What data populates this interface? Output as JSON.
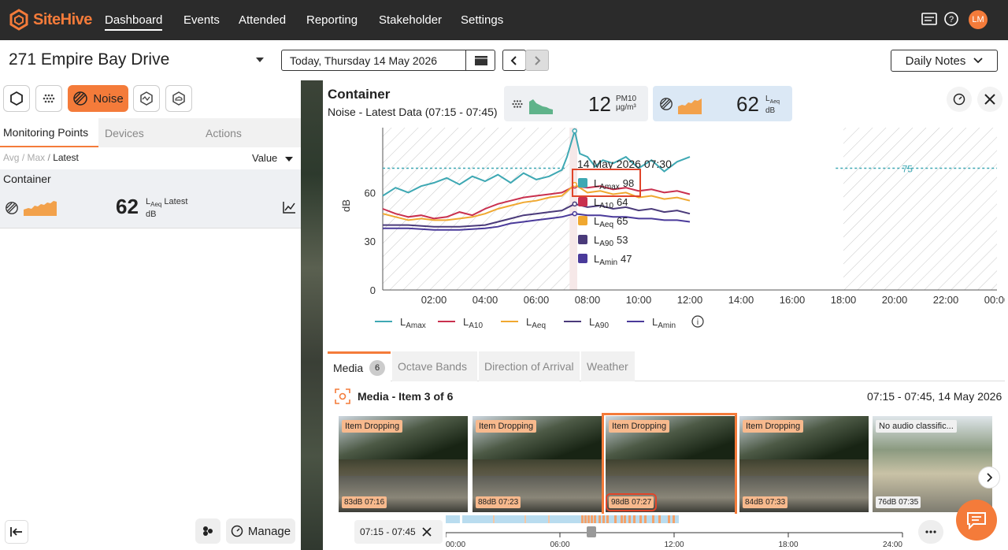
{
  "nav": {
    "brand": "SiteHive",
    "items": [
      {
        "label": "Dashboard",
        "active": true
      },
      {
        "label": "Events"
      },
      {
        "label": "Attended"
      },
      {
        "label": "Reporting"
      },
      {
        "label": "Stakeholder"
      },
      {
        "label": "Settings"
      }
    ],
    "icons": [
      "notes-icon",
      "help-icon"
    ],
    "avatar": "LM"
  },
  "header": {
    "site": "271 Empire Bay Drive",
    "date": "Today, Thursday 14 May 2026",
    "daily_notes": "Daily Notes"
  },
  "filters": {
    "noise_label": "Noise"
  },
  "left": {
    "tabs": [
      "Monitoring Points",
      "Devices",
      "Actions"
    ],
    "crumb_avg": "Avg",
    "crumb_sep": "/",
    "crumb_max": "Max",
    "crumb_latest": "Latest",
    "value_label": "Value",
    "point": {
      "name": "Container",
      "value": "62",
      "metric_main": "L",
      "metric_sub": "Aeq",
      "metric_suffix": "Latest",
      "unit": "dB"
    },
    "manage": "Manage"
  },
  "panel": {
    "title": "Container",
    "subtitle": "Noise - Latest Data (07:15 - 07:45)",
    "pm": {
      "value": "12",
      "label": "PM10",
      "unit": "µg/m³"
    },
    "noise": {
      "value": "62",
      "label_main": "L",
      "label_sub": "Aeq",
      "unit": "dB"
    }
  },
  "chart_data": {
    "type": "line",
    "ylabel": "dB",
    "yticks": [
      "0",
      "30",
      "60"
    ],
    "ylim": [
      0,
      100
    ],
    "xticks": [
      "02:00",
      "04:00",
      "06:00",
      "08:00",
      "10:00",
      "12:00",
      "14:00",
      "16:00",
      "18:00",
      "20:00",
      "22:00",
      "00:00"
    ],
    "xlim": [
      0,
      24
    ],
    "threshold_label": "75",
    "threshold": 75,
    "tooltip": {
      "time": "14 May 2026 07:30",
      "rows": [
        {
          "main": "L",
          "sub": "Amax",
          "value": "98",
          "color": "#3ea8b3"
        },
        {
          "main": "L",
          "sub": "A10",
          "value": "64",
          "color": "#c9304e"
        },
        {
          "main": "L",
          "sub": "Aeq",
          "value": "65",
          "color": "#f0a830"
        },
        {
          "main": "L",
          "sub": "A90",
          "value": "53",
          "color": "#4a3a7a"
        },
        {
          "main": "L",
          "sub": "Amin",
          "value": "47",
          "color": "#4a3a9a"
        }
      ]
    },
    "series": [
      {
        "name": "LAmax",
        "color": "#3ea8b3",
        "points": [
          [
            0,
            58
          ],
          [
            0.5,
            63
          ],
          [
            1,
            60
          ],
          [
            1.5,
            64
          ],
          [
            2,
            66
          ],
          [
            2.5,
            69
          ],
          [
            3,
            65
          ],
          [
            3.5,
            70
          ],
          [
            4,
            67
          ],
          [
            4.5,
            71
          ],
          [
            5,
            66
          ],
          [
            5.5,
            72
          ],
          [
            6,
            68
          ],
          [
            6.5,
            70
          ],
          [
            7,
            74
          ],
          [
            7.2,
            82
          ],
          [
            7.5,
            98
          ],
          [
            7.7,
            84
          ],
          [
            8,
            82
          ],
          [
            8.3,
            76
          ],
          [
            8.6,
            80
          ],
          [
            9,
            78
          ],
          [
            9.5,
            82
          ],
          [
            10,
            75
          ],
          [
            10.5,
            80
          ],
          [
            11,
            73
          ],
          [
            11.5,
            79
          ],
          [
            12,
            82
          ]
        ]
      },
      {
        "name": "LA10",
        "color": "#c9304e",
        "points": [
          [
            0,
            50
          ],
          [
            0.5,
            47
          ],
          [
            1,
            45
          ],
          [
            1.5,
            46
          ],
          [
            2,
            44
          ],
          [
            2.5,
            45
          ],
          [
            3,
            48
          ],
          [
            3.5,
            46
          ],
          [
            4,
            50
          ],
          [
            4.5,
            53
          ],
          [
            5,
            55
          ],
          [
            5.5,
            57
          ],
          [
            6,
            58
          ],
          [
            6.5,
            59
          ],
          [
            7,
            60
          ],
          [
            7.5,
            64
          ],
          [
            8,
            63
          ],
          [
            8.5,
            64
          ],
          [
            9,
            62
          ],
          [
            9.5,
            63
          ],
          [
            10,
            61
          ],
          [
            10.5,
            62
          ],
          [
            11,
            60
          ],
          [
            11.5,
            61
          ],
          [
            12,
            59
          ]
        ]
      },
      {
        "name": "LAeq",
        "color": "#f0a830",
        "points": [
          [
            0,
            47
          ],
          [
            0.5,
            45
          ],
          [
            1,
            43
          ],
          [
            1.5,
            44
          ],
          [
            2,
            43
          ],
          [
            2.5,
            43
          ],
          [
            3,
            44
          ],
          [
            3.5,
            45
          ],
          [
            4,
            47
          ],
          [
            4.5,
            50
          ],
          [
            5,
            52
          ],
          [
            5.5,
            54
          ],
          [
            6,
            55
          ],
          [
            6.5,
            57
          ],
          [
            7,
            58
          ],
          [
            7.5,
            65
          ],
          [
            8,
            60
          ],
          [
            8.5,
            61
          ],
          [
            9,
            59
          ],
          [
            9.5,
            60
          ],
          [
            10,
            57
          ],
          [
            10.5,
            58
          ],
          [
            11,
            56
          ],
          [
            11.5,
            57
          ],
          [
            12,
            55
          ]
        ]
      },
      {
        "name": "LA90",
        "color": "#4a3a7a",
        "points": [
          [
            0,
            40
          ],
          [
            1,
            40
          ],
          [
            2,
            39
          ],
          [
            3,
            39
          ],
          [
            4,
            40
          ],
          [
            4.5,
            42
          ],
          [
            5,
            44
          ],
          [
            5.5,
            46
          ],
          [
            6,
            47
          ],
          [
            6.5,
            48
          ],
          [
            7,
            49
          ],
          [
            7.5,
            53
          ],
          [
            8,
            51
          ],
          [
            8.5,
            52
          ],
          [
            9,
            50
          ],
          [
            9.5,
            51
          ],
          [
            10,
            49
          ],
          [
            10.5,
            50
          ],
          [
            11,
            48
          ],
          [
            11.5,
            49
          ],
          [
            12,
            47
          ]
        ]
      },
      {
        "name": "LAmin",
        "color": "#4a3a9a",
        "points": [
          [
            0,
            38
          ],
          [
            1,
            38
          ],
          [
            2,
            37
          ],
          [
            3,
            37
          ],
          [
            4,
            38
          ],
          [
            4.5,
            39
          ],
          [
            5,
            41
          ],
          [
            5.5,
            42
          ],
          [
            6,
            43
          ],
          [
            6.5,
            44
          ],
          [
            7,
            45
          ],
          [
            7.5,
            47
          ],
          [
            8,
            46
          ],
          [
            8.5,
            46
          ],
          [
            9,
            45
          ],
          [
            9.5,
            45
          ],
          [
            10,
            44
          ],
          [
            10.5,
            44
          ],
          [
            11,
            43
          ],
          [
            11.5,
            43
          ],
          [
            12,
            42
          ]
        ]
      }
    ],
    "legend": [
      {
        "main": "L",
        "sub": "Amax",
        "color": "#3ea8b3"
      },
      {
        "main": "L",
        "sub": "A10",
        "color": "#c9304e"
      },
      {
        "main": "L",
        "sub": "Aeq",
        "color": "#f0a830"
      },
      {
        "main": "L",
        "sub": "A90",
        "color": "#4a3a7a"
      },
      {
        "main": "L",
        "sub": "Amin",
        "color": "#4a3a9a"
      }
    ]
  },
  "media": {
    "tabs": [
      {
        "label": "Media",
        "count": "6"
      },
      {
        "label": "Octave Bands"
      },
      {
        "label": "Direction of Arrival"
      },
      {
        "label": "Weather"
      }
    ],
    "title": "Media - Item 3 of 6",
    "range": "07:15 - 07:45, 14 May 2026",
    "items": [
      {
        "tag": "Item Dropping",
        "level": "83dB 07:16"
      },
      {
        "tag": "Item Dropping",
        "level": "88dB 07:23"
      },
      {
        "tag": "Item Dropping",
        "level": "98dB 07:27"
      },
      {
        "tag": "Item Dropping",
        "level": "84dB 07:33"
      },
      {
        "tag": "No audio classific...",
        "level": "76dB 07:35"
      }
    ]
  },
  "timeline": {
    "range_chip": "07:15 - 07:45",
    "ticks": [
      "00:00",
      "06:00",
      "12:00",
      "18:00",
      "24:00"
    ]
  },
  "colors": {
    "accent": "#f47b3a",
    "nav_bg": "#2b2b2b"
  }
}
